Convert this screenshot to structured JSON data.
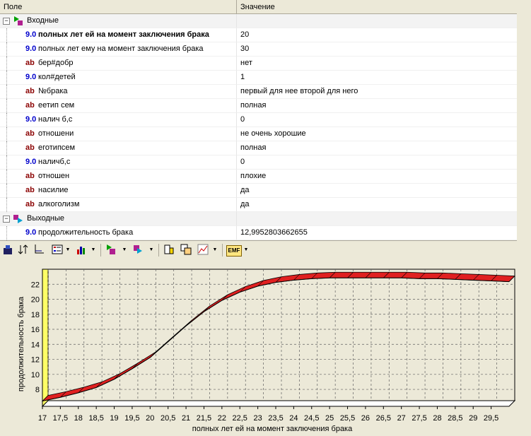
{
  "header": {
    "col_field": "Поле",
    "col_value": "Значение"
  },
  "groups": {
    "inputs": "Входные",
    "outputs": "Выходные"
  },
  "rows": [
    {
      "type": "9.0",
      "kind": "num",
      "label": "полных лет ей на момент заключения брака",
      "value": "20",
      "bold": true
    },
    {
      "type": "9.0",
      "kind": "num",
      "label": "полных лет ему на момент заключения брака",
      "value": "30"
    },
    {
      "type": "ab",
      "kind": "str",
      "label": "бер#добр",
      "value": "нет"
    },
    {
      "type": "9.0",
      "kind": "num",
      "label": "кол#детей",
      "value": "1"
    },
    {
      "type": "ab",
      "kind": "str",
      "label": "№брака",
      "value": "первый для нее второй для него"
    },
    {
      "type": "ab",
      "kind": "str",
      "label": "еетип сем",
      "value": "полная"
    },
    {
      "type": "9.0",
      "kind": "num",
      "label": "налич б,с",
      "value": "0"
    },
    {
      "type": "ab",
      "kind": "str",
      "label": "отношени",
      "value": "не очень хорошие"
    },
    {
      "type": "ab",
      "kind": "str",
      "label": "еготипсем",
      "value": "полная"
    },
    {
      "type": "9.0",
      "kind": "num",
      "label": "наличб,с",
      "value": "0"
    },
    {
      "type": "ab",
      "kind": "str",
      "label": "отношен",
      "value": "плохие"
    },
    {
      "type": "ab",
      "kind": "str",
      "label": "насилие",
      "value": "да"
    },
    {
      "type": "ab",
      "kind": "str",
      "label": "алкоголизм",
      "value": "да"
    }
  ],
  "outputs": [
    {
      "type": "9.0",
      "kind": "num",
      "label": "продолжительность брака",
      "value": "12,9952803662655"
    }
  ],
  "toolbar": {
    "emf_label": "EMF",
    "icons": [
      "chart-type-icon",
      "sort-icon",
      "axis-icon",
      "legend-icon",
      "bar-chart-icon",
      "input-select-icon",
      "output-select-icon",
      "copy-icon",
      "duplicate-icon",
      "line-chart-icon",
      "export-emf-icon"
    ]
  },
  "colors": {
    "band_fill": "#e02020",
    "band_stroke": "#000000",
    "wall_left": "#ffff66",
    "plot_bg": "#ece9d8",
    "type_num": "#0000cc",
    "type_str": "#8b0000"
  },
  "chart_data": {
    "type": "area",
    "xlabel": "полных лет ей на момент заключения брака",
    "ylabel": "продолжительность брака",
    "xlim": [
      17,
      30
    ],
    "ylim": [
      6.5,
      24
    ],
    "x_ticks": [
      "17",
      "17,5",
      "18",
      "18,5",
      "19",
      "19,5",
      "20",
      "20,5",
      "21",
      "21,5",
      "22",
      "22,5",
      "23",
      "23,5",
      "24",
      "24,5",
      "25",
      "25,5",
      "26",
      "26,5",
      "27",
      "27,5",
      "28",
      "28,5",
      "29",
      "29,5"
    ],
    "y_ticks": [
      "8",
      "10",
      "12",
      "14",
      "16",
      "18",
      "20",
      "22"
    ],
    "grid": true,
    "x": [
      17,
      17.5,
      18,
      18.5,
      19,
      19.5,
      20,
      20.5,
      21,
      21.5,
      22,
      22.5,
      23,
      23.5,
      24,
      24.5,
      25,
      25.5,
      26,
      26.5,
      27,
      27.5,
      28,
      28.5,
      29,
      29.5,
      30
    ],
    "series": [
      {
        "values": [
          7.2,
          7.7,
          8.3,
          9.0,
          10.1,
          11.5,
          13.0,
          15.1,
          17.2,
          19.1,
          20.6,
          21.7,
          22.5,
          23.0,
          23.3,
          23.5,
          23.6,
          23.6,
          23.6,
          23.6,
          23.6,
          23.5,
          23.5,
          23.4,
          23.3,
          23.2,
          23.1
        ]
      }
    ]
  }
}
